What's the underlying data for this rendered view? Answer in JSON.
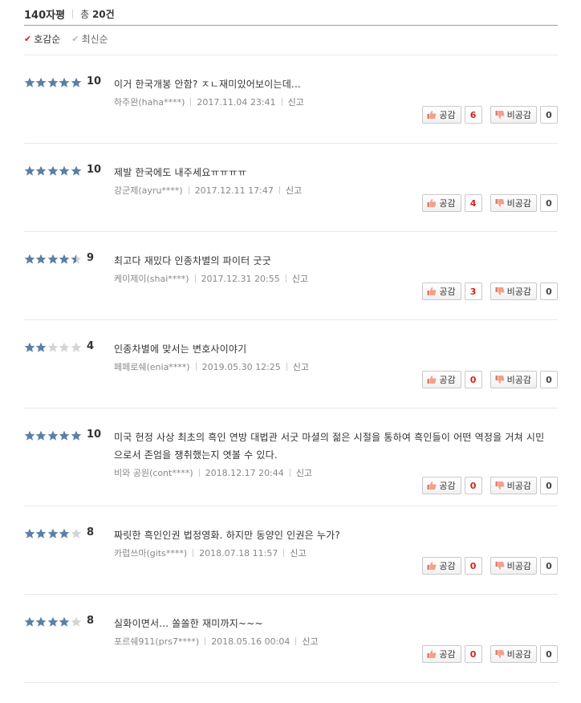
{
  "header": {
    "title": "140자평",
    "total_prefix": "총",
    "total_count": "20",
    "total_suffix": "건"
  },
  "sort": {
    "likes_label": "호감순",
    "recent_label": "최신순"
  },
  "buttons": {
    "like_label": "공감",
    "dislike_label": "비공감",
    "report_label": "신고"
  },
  "colors": {
    "star_fill": "#5b7fa6",
    "star_empty": "#d4d4d4",
    "accent_red": "#d0241a"
  },
  "reviews": [
    {
      "rating": 5,
      "score": "10",
      "text": "이거 한국개봉 안함? ㅈㄴ재미있어보이는데...",
      "author": "하주완(haha****)",
      "date": "2017.11.04 23:41",
      "likes": "6",
      "dislikes": "0"
    },
    {
      "rating": 5,
      "score": "10",
      "text": "제발 한국에도 내주세요ㅠㅠㅠㅠ",
      "author": "강군제(ayru****)",
      "date": "2017.12.11 17:47",
      "likes": "4",
      "dislikes": "0"
    },
    {
      "rating": 4.5,
      "score": "9",
      "text": "최고다 재밌다 인종차별의 파이터 굿굿",
      "author": "케이제이(shai****)",
      "date": "2017.12.31 20:55",
      "likes": "3",
      "dislikes": "0"
    },
    {
      "rating": 2,
      "score": "4",
      "text": "인종차별에 맞서는 변호사이야기",
      "author": "페페로쉐(enia****)",
      "date": "2019.05.30 12:25",
      "likes": "0",
      "dislikes": "0"
    },
    {
      "rating": 5,
      "score": "10",
      "text": "미국 헌정 사상 최초의 흑인 연방 대법관 서굿 마셜의 젊은 시절을 통하여 흑인들이 어떤 역정을 거쳐 시민으로서 존엄을 쟁취했는지 엿볼 수 있다.",
      "author": "비와 공원(cont****)",
      "date": "2018.12.17 20:44",
      "likes": "0",
      "dislikes": "0"
    },
    {
      "rating": 4,
      "score": "8",
      "text": "짜릿한 흑인인권 법정영화. 하지만 동양인 인권은 누가?",
      "author": "카럽쓰마(gits****)",
      "date": "2018.07.18 11:57",
      "likes": "0",
      "dislikes": "0"
    },
    {
      "rating": 4,
      "score": "8",
      "text": "실화이면서... 쏠쏠한 재미까지~~~",
      "author": "포르쉐911(prs7****)",
      "date": "2018.05.16 00:04",
      "likes": "0",
      "dislikes": "0"
    }
  ]
}
